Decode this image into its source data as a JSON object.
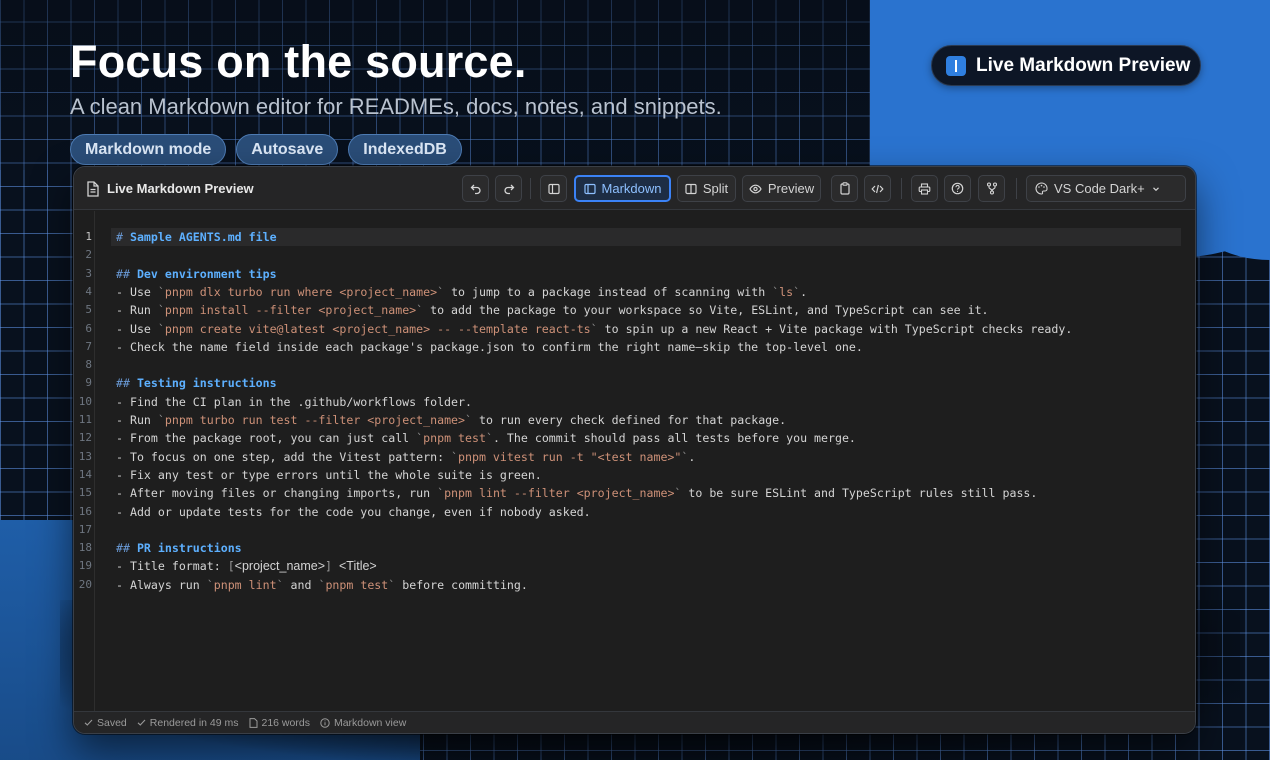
{
  "hero": {
    "title": "Focus on the source.",
    "subtitle": "A clean Markdown editor for READMEs, docs, notes, and snippets.",
    "chips": [
      "Markdown mode",
      "Autosave",
      "IndexedDB"
    ]
  },
  "badge": {
    "label": "Live Markdown Preview",
    "icon": "editor-icon"
  },
  "window": {
    "title": "Live Markdown Preview",
    "toolbar": {
      "undo_icon": "undo-icon",
      "redo_icon": "redo-icon",
      "sidebar_icon": "sidebar-toggle-icon",
      "markdown_label": "Markdown",
      "split_label": "Split",
      "preview_label": "Preview",
      "copy_icon": "clipboard-icon",
      "embed_icon": "code-icon",
      "print_icon": "printer-icon",
      "help_icon": "help-icon",
      "fork_icon": "git-fork-icon",
      "theme_label": "VS Code Dark+"
    },
    "active_view": "Markdown",
    "current_line": 1,
    "lines": [
      [
        {
          "t": "hash",
          "v": "# "
        },
        {
          "t": "head",
          "v": "Sample AGENTS.md file"
        }
      ],
      [],
      [
        {
          "t": "hash",
          "v": "## "
        },
        {
          "t": "head",
          "v": "Dev environment tips"
        }
      ],
      [
        {
          "t": "plain",
          "v": "- Use "
        },
        {
          "t": "tick",
          "v": "`"
        },
        {
          "t": "code",
          "v": "pnpm dlx turbo run where <project_name>"
        },
        {
          "t": "tick",
          "v": "`"
        },
        {
          "t": "plain",
          "v": " to jump to a package instead of scanning with "
        },
        {
          "t": "tick",
          "v": "`"
        },
        {
          "t": "code",
          "v": "ls"
        },
        {
          "t": "tick",
          "v": "`"
        },
        {
          "t": "plain",
          "v": "."
        }
      ],
      [
        {
          "t": "plain",
          "v": "- Run "
        },
        {
          "t": "tick",
          "v": "`"
        },
        {
          "t": "code",
          "v": "pnpm install --filter <project_name>"
        },
        {
          "t": "tick",
          "v": "`"
        },
        {
          "t": "plain",
          "v": " to add the package to your workspace so Vite, ESLint, and TypeScript can see it."
        }
      ],
      [
        {
          "t": "plain",
          "v": "- Use "
        },
        {
          "t": "tick",
          "v": "`"
        },
        {
          "t": "code",
          "v": "pnpm create vite@latest <project_name> -- --template react-ts"
        },
        {
          "t": "tick",
          "v": "`"
        },
        {
          "t": "plain",
          "v": " to spin up a new React + Vite package with TypeScript checks ready."
        }
      ],
      [
        {
          "t": "plain",
          "v": "- Check the name field inside each package's package.json to confirm the right name—skip the top-level one."
        }
      ],
      [],
      [
        {
          "t": "hash",
          "v": "## "
        },
        {
          "t": "head",
          "v": "Testing instructions"
        }
      ],
      [
        {
          "t": "plain",
          "v": "- Find the CI plan in the .github/workflows folder."
        }
      ],
      [
        {
          "t": "plain",
          "v": "- Run "
        },
        {
          "t": "tick",
          "v": "`"
        },
        {
          "t": "code",
          "v": "pnpm turbo run test --filter <project_name>"
        },
        {
          "t": "tick",
          "v": "`"
        },
        {
          "t": "plain",
          "v": " to run every check defined for that package."
        }
      ],
      [
        {
          "t": "plain",
          "v": "- From the package root, you can just call "
        },
        {
          "t": "tick",
          "v": "`"
        },
        {
          "t": "code",
          "v": "pnpm test"
        },
        {
          "t": "tick",
          "v": "`"
        },
        {
          "t": "plain",
          "v": ". The commit should pass all tests before you merge."
        }
      ],
      [
        {
          "t": "plain",
          "v": "- To focus on one step, add the Vitest pattern: "
        },
        {
          "t": "tick",
          "v": "`"
        },
        {
          "t": "code",
          "v": "pnpm vitest run -t \"<test name>\""
        },
        {
          "t": "tick",
          "v": "`"
        },
        {
          "t": "plain",
          "v": "."
        }
      ],
      [
        {
          "t": "plain",
          "v": "- Fix any test or type errors until the whole suite is green."
        }
      ],
      [
        {
          "t": "plain",
          "v": "- After moving files or changing imports, run "
        },
        {
          "t": "tick",
          "v": "`"
        },
        {
          "t": "code",
          "v": "pnpm lint --filter <project_name>"
        },
        {
          "t": "tick",
          "v": "`"
        },
        {
          "t": "plain",
          "v": " to be sure ESLint and TypeScript rules still pass."
        }
      ],
      [
        {
          "t": "plain",
          "v": "- Add or update tests for the code you change, even if nobody asked."
        }
      ],
      [],
      [
        {
          "t": "hash",
          "v": "## "
        },
        {
          "t": "head",
          "v": "PR instructions"
        }
      ],
      [
        {
          "t": "plain",
          "v": "- Title format: "
        },
        {
          "t": "brk",
          "v": "["
        },
        {
          "t": "sans",
          "v": "<project_name>"
        },
        {
          "t": "brk",
          "v": "]"
        },
        {
          "t": "plain",
          "v": " "
        },
        {
          "t": "sans",
          "v": "<Title>"
        }
      ],
      [
        {
          "t": "plain",
          "v": "- Always run "
        },
        {
          "t": "tick",
          "v": "`"
        },
        {
          "t": "code",
          "v": "pnpm lint"
        },
        {
          "t": "tick",
          "v": "`"
        },
        {
          "t": "plain",
          "v": " and "
        },
        {
          "t": "tick",
          "v": "`"
        },
        {
          "t": "code",
          "v": "pnpm test"
        },
        {
          "t": "tick",
          "v": "`"
        },
        {
          "t": "plain",
          "v": " before committing."
        }
      ]
    ],
    "status": {
      "saved": "Saved",
      "rendered": "Rendered in 49 ms",
      "words": "216 words",
      "view": "Markdown view"
    }
  },
  "colors": {
    "accent": "#3b82f6",
    "heading": "#5db0ff",
    "inline_code": "#ce9178",
    "editor_bg": "#1e1e1e",
    "brand_blue": "#2a73cf"
  }
}
